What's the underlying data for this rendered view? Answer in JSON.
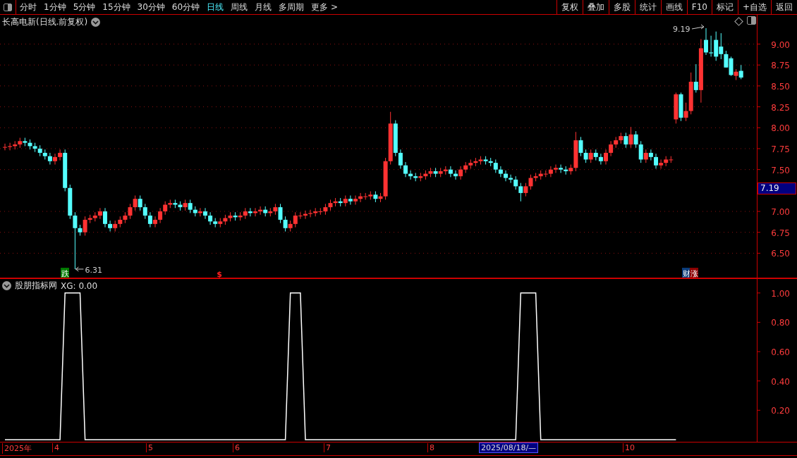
{
  "toolbar": {
    "tabs": [
      {
        "label": "分时",
        "selected": false
      },
      {
        "label": "1分钟",
        "selected": false
      },
      {
        "label": "5分钟",
        "selected": false
      },
      {
        "label": "15分钟",
        "selected": false
      },
      {
        "label": "30分钟",
        "selected": false
      },
      {
        "label": "60分钟",
        "selected": false
      },
      {
        "label": "日线",
        "selected": true
      },
      {
        "label": "周线",
        "selected": false
      },
      {
        "label": "月线",
        "selected": false
      },
      {
        "label": "多周期",
        "selected": false
      },
      {
        "label": "更多 >",
        "selected": false
      }
    ],
    "buttons": [
      "复权",
      "叠加",
      "多股",
      "统计",
      "画线",
      "F10",
      "标记",
      "+自选",
      "返回"
    ]
  },
  "main_chart": {
    "title": "长高电新(日线.前复权)",
    "price_tag": "7.19",
    "signals": [
      {
        "text": "跌",
        "kind": "down"
      },
      {
        "text": "$",
        "kind": "dollar"
      },
      {
        "text": "财",
        "kind": "finance"
      },
      {
        "text": "涨",
        "kind": "up"
      }
    ],
    "chart_data": {
      "type": "candlestick",
      "grid": true,
      "ylim": [
        6.2,
        9.35
      ],
      "yticks": [
        {
          "value": 6.5,
          "label": "6.50"
        },
        {
          "value": 6.75,
          "label": "6.75"
        },
        {
          "value": 7.0,
          "label": "7.00"
        },
        {
          "value": 7.5,
          "label": "7.50"
        },
        {
          "value": 7.75,
          "label": "7.75"
        },
        {
          "value": 8.0,
          "label": "8.00"
        },
        {
          "value": 8.25,
          "label": "8.25"
        },
        {
          "value": 8.5,
          "label": "8.50"
        },
        {
          "value": 8.75,
          "label": "8.75"
        },
        {
          "value": 9.0,
          "label": "9.00"
        }
      ],
      "categories": [
        null,
        null,
        null,
        null,
        null,
        null,
        null,
        null,
        null,
        null,
        null,
        null,
        null,
        null,
        null,
        null,
        null,
        null,
        null,
        null,
        null,
        null,
        null,
        null,
        null,
        null,
        null,
        null,
        null,
        null,
        null,
        null,
        null,
        null,
        null,
        null,
        null,
        null,
        null,
        null,
        null,
        null,
        null,
        null,
        null,
        null,
        null,
        null,
        null,
        null,
        null,
        null,
        null,
        null,
        null,
        null,
        null,
        null,
        null,
        null,
        null,
        null,
        null,
        null,
        null,
        null,
        null,
        null,
        null,
        null,
        null,
        null,
        null,
        null,
        null,
        null,
        null,
        null,
        null,
        null,
        null,
        null,
        null,
        null,
        null,
        null,
        null,
        null,
        null,
        null,
        null,
        null,
        null,
        null,
        null,
        null,
        null,
        null,
        null,
        null,
        null,
        null,
        null,
        null,
        null,
        null,
        null,
        null,
        null,
        null,
        null,
        null,
        null,
        null,
        null,
        null,
        null,
        null,
        null,
        null,
        null,
        null,
        null,
        null,
        null,
        null,
        null,
        null,
        null,
        null,
        null,
        null,
        null,
        null,
        null,
        null,
        null,
        null,
        null,
        null,
        null,
        null,
        null,
        null,
        null,
        null,
        null,
        null
      ],
      "ohlc": [
        [
          7.77,
          7.81,
          7.73,
          7.77
        ],
        [
          7.77,
          7.82,
          7.73,
          7.78
        ],
        [
          7.78,
          7.84,
          7.74,
          7.8
        ],
        [
          7.8,
          7.88,
          7.76,
          7.84
        ],
        [
          7.84,
          7.88,
          7.78,
          7.82
        ],
        [
          7.82,
          7.86,
          7.74,
          7.78
        ],
        [
          7.78,
          7.82,
          7.71,
          7.75
        ],
        [
          7.75,
          7.79,
          7.66,
          7.7
        ],
        [
          7.7,
          7.74,
          7.62,
          7.66
        ],
        [
          7.66,
          7.7,
          7.56,
          7.6
        ],
        [
          7.6,
          7.69,
          7.56,
          7.65
        ],
        [
          7.65,
          7.74,
          7.61,
          7.7
        ],
        [
          7.7,
          7.74,
          7.24,
          7.28
        ],
        [
          7.28,
          7.32,
          6.91,
          6.95
        ],
        [
          6.95,
          6.99,
          6.31,
          6.8
        ],
        [
          6.8,
          6.84,
          6.71,
          6.75
        ],
        [
          6.75,
          6.94,
          6.71,
          6.9
        ],
        [
          6.9,
          6.96,
          6.86,
          6.92
        ],
        [
          6.92,
          6.99,
          6.88,
          6.95
        ],
        [
          6.95,
          7.04,
          6.91,
          7.0
        ],
        [
          7.0,
          7.04,
          6.81,
          6.85
        ],
        [
          6.85,
          6.89,
          6.76,
          6.8
        ],
        [
          6.8,
          6.89,
          6.76,
          6.85
        ],
        [
          6.85,
          6.94,
          6.81,
          6.9
        ],
        [
          6.9,
          6.99,
          6.86,
          6.95
        ],
        [
          6.95,
          7.09,
          6.91,
          7.05
        ],
        [
          7.05,
          7.19,
          7.01,
          7.15
        ],
        [
          7.15,
          7.19,
          7.01,
          7.05
        ],
        [
          7.05,
          7.09,
          6.91,
          6.95
        ],
        [
          6.95,
          6.99,
          6.81,
          6.85
        ],
        [
          6.85,
          6.94,
          6.81,
          6.9
        ],
        [
          6.9,
          7.04,
          6.86,
          7.0
        ],
        [
          7.0,
          7.12,
          6.96,
          7.08
        ],
        [
          7.08,
          7.14,
          7.04,
          7.1
        ],
        [
          7.1,
          7.14,
          7.04,
          7.08
        ],
        [
          7.08,
          7.12,
          7.01,
          7.05
        ],
        [
          7.05,
          7.14,
          7.01,
          7.1
        ],
        [
          7.1,
          7.14,
          6.98,
          7.02
        ],
        [
          7.02,
          7.06,
          6.94,
          6.98
        ],
        [
          6.98,
          7.04,
          6.94,
          7.0
        ],
        [
          7.0,
          7.04,
          6.91,
          6.95
        ],
        [
          6.95,
          6.99,
          6.84,
          6.88
        ],
        [
          6.88,
          6.92,
          6.81,
          6.85
        ],
        [
          6.85,
          6.92,
          6.81,
          6.88
        ],
        [
          6.88,
          6.96,
          6.84,
          6.92
        ],
        [
          6.92,
          6.99,
          6.88,
          6.95
        ],
        [
          6.95,
          6.99,
          6.89,
          6.93
        ],
        [
          6.93,
          6.99,
          6.89,
          6.95
        ],
        [
          6.95,
          7.04,
          6.91,
          7.0
        ],
        [
          7.0,
          7.04,
          6.94,
          6.98
        ],
        [
          6.98,
          7.04,
          6.94,
          7.0
        ],
        [
          7.0,
          7.06,
          6.96,
          7.02
        ],
        [
          7.02,
          7.06,
          6.94,
          6.98
        ],
        [
          6.98,
          7.04,
          6.94,
          7.0
        ],
        [
          7.0,
          7.09,
          6.96,
          7.05
        ],
        [
          7.05,
          7.09,
          6.86,
          6.9
        ],
        [
          6.9,
          6.94,
          6.76,
          6.8
        ],
        [
          6.8,
          6.89,
          6.76,
          6.85
        ],
        [
          6.85,
          6.99,
          6.81,
          6.95
        ],
        [
          6.95,
          6.99,
          6.91,
          6.95
        ],
        [
          6.95,
          7.01,
          6.91,
          6.97
        ],
        [
          6.97,
          7.02,
          6.93,
          6.98
        ],
        [
          6.98,
          7.04,
          6.94,
          7.0
        ],
        [
          7.0,
          7.04,
          6.96,
          7.0
        ],
        [
          7.0,
          7.09,
          6.96,
          7.05
        ],
        [
          7.05,
          7.14,
          7.01,
          7.1
        ],
        [
          7.1,
          7.16,
          7.06,
          7.12
        ],
        [
          7.12,
          7.16,
          7.06,
          7.1
        ],
        [
          7.1,
          7.19,
          7.06,
          7.15
        ],
        [
          7.15,
          7.19,
          7.08,
          7.12
        ],
        [
          7.12,
          7.19,
          7.08,
          7.15
        ],
        [
          7.15,
          7.22,
          7.11,
          7.18
        ],
        [
          7.18,
          7.22,
          7.14,
          7.18
        ],
        [
          7.18,
          7.24,
          7.14,
          7.2
        ],
        [
          7.2,
          7.24,
          7.11,
          7.15
        ],
        [
          7.15,
          7.22,
          7.11,
          7.18
        ],
        [
          7.18,
          7.64,
          7.14,
          7.6
        ],
        [
          7.6,
          8.19,
          7.56,
          8.05
        ],
        [
          8.05,
          8.09,
          7.66,
          7.7
        ],
        [
          7.7,
          7.74,
          7.51,
          7.55
        ],
        [
          7.55,
          7.59,
          7.41,
          7.45
        ],
        [
          7.45,
          7.49,
          7.38,
          7.42
        ],
        [
          7.42,
          7.46,
          7.36,
          7.4
        ],
        [
          7.4,
          7.46,
          7.36,
          7.42
        ],
        [
          7.42,
          7.49,
          7.38,
          7.45
        ],
        [
          7.45,
          7.52,
          7.41,
          7.48
        ],
        [
          7.48,
          7.52,
          7.41,
          7.45
        ],
        [
          7.45,
          7.52,
          7.41,
          7.48
        ],
        [
          7.48,
          7.54,
          7.44,
          7.5
        ],
        [
          7.5,
          7.54,
          7.41,
          7.45
        ],
        [
          7.45,
          7.49,
          7.38,
          7.42
        ],
        [
          7.42,
          7.54,
          7.38,
          7.5
        ],
        [
          7.5,
          7.59,
          7.46,
          7.55
        ],
        [
          7.55,
          7.62,
          7.51,
          7.58
        ],
        [
          7.58,
          7.64,
          7.54,
          7.6
        ],
        [
          7.6,
          7.66,
          7.56,
          7.62
        ],
        [
          7.62,
          7.66,
          7.56,
          7.6
        ],
        [
          7.6,
          7.64,
          7.54,
          7.58
        ],
        [
          7.58,
          7.62,
          7.46,
          7.5
        ],
        [
          7.5,
          7.54,
          7.41,
          7.45
        ],
        [
          7.45,
          7.49,
          7.36,
          7.4
        ],
        [
          7.4,
          7.44,
          7.34,
          7.38
        ],
        [
          7.38,
          7.42,
          7.26,
          7.3
        ],
        [
          7.3,
          7.34,
          7.12,
          7.22
        ],
        [
          7.22,
          7.34,
          7.18,
          7.3
        ],
        [
          7.3,
          7.44,
          7.26,
          7.4
        ],
        [
          7.4,
          7.46,
          7.36,
          7.42
        ],
        [
          7.42,
          7.49,
          7.38,
          7.45
        ],
        [
          7.45,
          7.49,
          7.41,
          7.45
        ],
        [
          7.45,
          7.54,
          7.41,
          7.5
        ],
        [
          7.5,
          7.56,
          7.46,
          7.52
        ],
        [
          7.52,
          7.56,
          7.46,
          7.5
        ],
        [
          7.5,
          7.54,
          7.44,
          7.48
        ],
        [
          7.48,
          7.56,
          7.44,
          7.52
        ],
        [
          7.52,
          7.95,
          7.48,
          7.85
        ],
        [
          7.85,
          7.89,
          7.66,
          7.7
        ],
        [
          7.7,
          7.74,
          7.58,
          7.62
        ],
        [
          7.62,
          7.74,
          7.58,
          7.7
        ],
        [
          7.7,
          7.74,
          7.61,
          7.65
        ],
        [
          7.65,
          7.69,
          7.56,
          7.6
        ],
        [
          7.6,
          7.74,
          7.56,
          7.7
        ],
        [
          7.7,
          7.84,
          7.66,
          7.8
        ],
        [
          7.8,
          7.89,
          7.76,
          7.85
        ],
        [
          7.85,
          7.94,
          7.81,
          7.9
        ],
        [
          7.9,
          7.94,
          7.76,
          7.8
        ],
        [
          7.8,
          8.01,
          7.76,
          7.92
        ],
        [
          7.92,
          7.96,
          7.76,
          7.8
        ],
        [
          7.8,
          7.84,
          7.58,
          7.62
        ],
        [
          7.62,
          7.74,
          7.58,
          7.7
        ],
        [
          7.7,
          7.74,
          7.61,
          7.65
        ],
        [
          7.65,
          7.69,
          7.51,
          7.55
        ],
        [
          7.55,
          7.62,
          7.51,
          7.58
        ],
        [
          7.58,
          7.66,
          7.54,
          7.62
        ],
        [
          7.62,
          7.66,
          7.58,
          7.62
        ],
        [
          8.1,
          8.42,
          8.05,
          8.4
        ],
        [
          8.4,
          8.42,
          8.08,
          8.12
        ],
        [
          8.12,
          8.3,
          8.08,
          8.2
        ],
        [
          8.2,
          8.66,
          8.16,
          8.55
        ],
        [
          8.55,
          8.76,
          8.42,
          8.45
        ],
        [
          8.45,
          9.06,
          8.3,
          8.95
        ],
        [
          9.05,
          9.19,
          8.87,
          8.9
        ],
        [
          8.9,
          9.1,
          8.85,
          8.89
        ],
        [
          9.05,
          9.15,
          8.8,
          8.85
        ],
        [
          8.97,
          9.13,
          8.82,
          8.88
        ],
        [
          8.88,
          8.92,
          8.72,
          8.72
        ],
        [
          8.83,
          8.85,
          8.62,
          8.63
        ],
        [
          8.62,
          8.7,
          8.57,
          8.67
        ],
        [
          8.68,
          8.75,
          8.58,
          8.6
        ]
      ],
      "annotations": [
        "9.19",
        "6.31"
      ]
    }
  },
  "indicator_chart": {
    "name": "股朋指标网",
    "reading": "XG: 0.00",
    "chart_data": {
      "type": "line",
      "ylim": [
        -0.015,
        1.1
      ],
      "yticks": [
        {
          "value": 0.2,
          "label": "0.20"
        },
        {
          "value": 0.4,
          "label": "0.40"
        },
        {
          "value": 0.6,
          "label": "0.60"
        },
        {
          "value": 0.8,
          "label": "0.80"
        },
        {
          "value": 1.0,
          "label": "1.00"
        }
      ],
      "categories": [
        null,
        null,
        null,
        null,
        null,
        null,
        null,
        null,
        null,
        null,
        null,
        null,
        null,
        null,
        null,
        null,
        null,
        null,
        null,
        null,
        null,
        null,
        null,
        null,
        null,
        null,
        null,
        null,
        null,
        null,
        null,
        null,
        null,
        null,
        null,
        null,
        null,
        null,
        null,
        null,
        null,
        null,
        null,
        null,
        null,
        null,
        null,
        null,
        null,
        null,
        null,
        null,
        null,
        null,
        null,
        null,
        null,
        null,
        null,
        null,
        null,
        null,
        null,
        null,
        null,
        null,
        null,
        null,
        null,
        null,
        null,
        null,
        null,
        null,
        null,
        null,
        null,
        null,
        null,
        null,
        null,
        null,
        null,
        null,
        null,
        null,
        null,
        null,
        null,
        null,
        null,
        null,
        null,
        null,
        null,
        null,
        null,
        null,
        null,
        null,
        null,
        null,
        null,
        null,
        null,
        null,
        null,
        null,
        null,
        null,
        null,
        null,
        null,
        null,
        null,
        null,
        null,
        null,
        null,
        null,
        null,
        null,
        null,
        null,
        null,
        null,
        null,
        null,
        null,
        null,
        null,
        null,
        null,
        null,
        null
      ],
      "series": [
        {
          "color": "#ffffff",
          "values": [
            0,
            0,
            0,
            0,
            0,
            0,
            0,
            0,
            0,
            0,
            0,
            0,
            1,
            1,
            1,
            1,
            0,
            0,
            0,
            0,
            0,
            0,
            0,
            0,
            0,
            0,
            0,
            0,
            0,
            0,
            0,
            0,
            0,
            0,
            0,
            0,
            0,
            0,
            0,
            0,
            0,
            0,
            0,
            0,
            0,
            0,
            0,
            0,
            0,
            0,
            0,
            0,
            0,
            0,
            0,
            0,
            0,
            1,
            1,
            1,
            0,
            0,
            0,
            0,
            0,
            0,
            0,
            0,
            0,
            0,
            0,
            0,
            0,
            0,
            0,
            0,
            0,
            0,
            0,
            0,
            0,
            0,
            0,
            0,
            0,
            0,
            0,
            0,
            0,
            0,
            0,
            0,
            0,
            0,
            0,
            0,
            0,
            0,
            0,
            0,
            0,
            0,
            0,
            1,
            1,
            1,
            1,
            0,
            0,
            0,
            0,
            0,
            0,
            0,
            0,
            0,
            0,
            0,
            0,
            0,
            0,
            0,
            0,
            0,
            0,
            0,
            0,
            0,
            0,
            0,
            0,
            0,
            0,
            0,
            0
          ]
        }
      ]
    }
  },
  "time_axis": [
    {
      "label": "2025年",
      "selected": false
    },
    {
      "label": "4",
      "selected": false
    },
    {
      "label": "5",
      "selected": false
    },
    {
      "label": "6",
      "selected": false
    },
    {
      "label": "7",
      "selected": false
    },
    {
      "label": "8",
      "selected": false
    },
    {
      "label": "2025/08/18/—",
      "selected": true
    },
    {
      "label": "10",
      "selected": false
    }
  ]
}
